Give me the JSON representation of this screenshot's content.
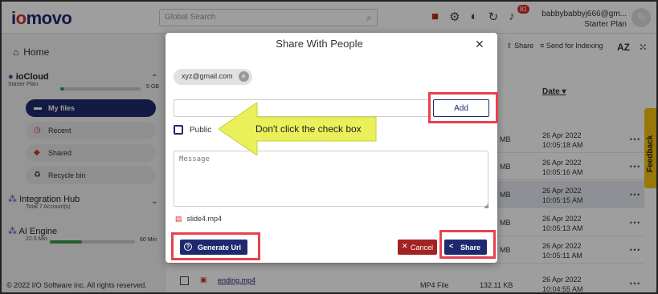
{
  "app": {
    "logo_prefix": "i",
    "logo_dot": "o",
    "logo_rest": "movo"
  },
  "search": {
    "placeholder": "Global Search",
    "icon": "search-icon"
  },
  "topbar": {
    "notification_count": "81",
    "user_name": "babbybabbyj666@gm...",
    "user_plan": "Starter Plan",
    "avatar_initials": "Bj"
  },
  "sidebar": {
    "home_label": "Home",
    "iocloud": {
      "title": "ioCloud",
      "plan": "Starter Plan",
      "size": "5 GB",
      "usage": 0.05
    },
    "items": [
      {
        "label": "My files",
        "icon": "folder-icon",
        "active": true
      },
      {
        "label": "Recent",
        "icon": "recent-icon",
        "active": false
      },
      {
        "label": "Shared",
        "icon": "shared-icon",
        "active": false
      },
      {
        "label": "Recycle bin",
        "icon": "recycle-icon",
        "active": false
      }
    ],
    "integration": {
      "title": "Integration Hub",
      "sub": "Total 7 Account(s)"
    },
    "ai": {
      "title": "AI Engine",
      "min_used": "22.5 Min",
      "min_total": "60 Min",
      "usage": 0.375
    },
    "copyright": "© 2022 I/O Software inc. All rights reserved."
  },
  "main": {
    "share_label": "Share",
    "send_index_label": "Send for Indexing",
    "sort_label": "AZ",
    "date_header": "Date",
    "rows": [
      {
        "size": "MB",
        "date": "26 Apr 2022",
        "time": "10:05:18 AM",
        "selected": false
      },
      {
        "size": "MB",
        "date": "26 Apr 2022",
        "time": "10:05:16 AM",
        "selected": false
      },
      {
        "size": "MB",
        "date": "26 Apr 2022",
        "time": "10:05:15 AM",
        "selected": true
      },
      {
        "size": "MB",
        "date": "26 Apr 2022",
        "time": "10:05:13 AM",
        "selected": false
      },
      {
        "size": "MB",
        "date": "26 Apr 2022",
        "time": "10:05:11 AM",
        "selected": false
      }
    ],
    "last_row": {
      "name": "ending.mp4",
      "type": "MP4 File",
      "size": "132.11 KB",
      "date": "26 Apr 2022",
      "time": "10:04:55 AM"
    },
    "feedback_label": "Feedback"
  },
  "modal": {
    "title": "Share With People",
    "chip_email": "xyz@gmail.com",
    "add_label": "Add",
    "public_label": "Public",
    "message_placeholder": "Message",
    "file_name": "slide4.mp4",
    "generate_url_label": "Generate Url",
    "cancel_label": "Cancel",
    "share_label": "Share"
  },
  "annotation": {
    "text": "Don't click the check box",
    "highlight_color": "#e8414e",
    "arrow_color": "#eaf05a"
  }
}
